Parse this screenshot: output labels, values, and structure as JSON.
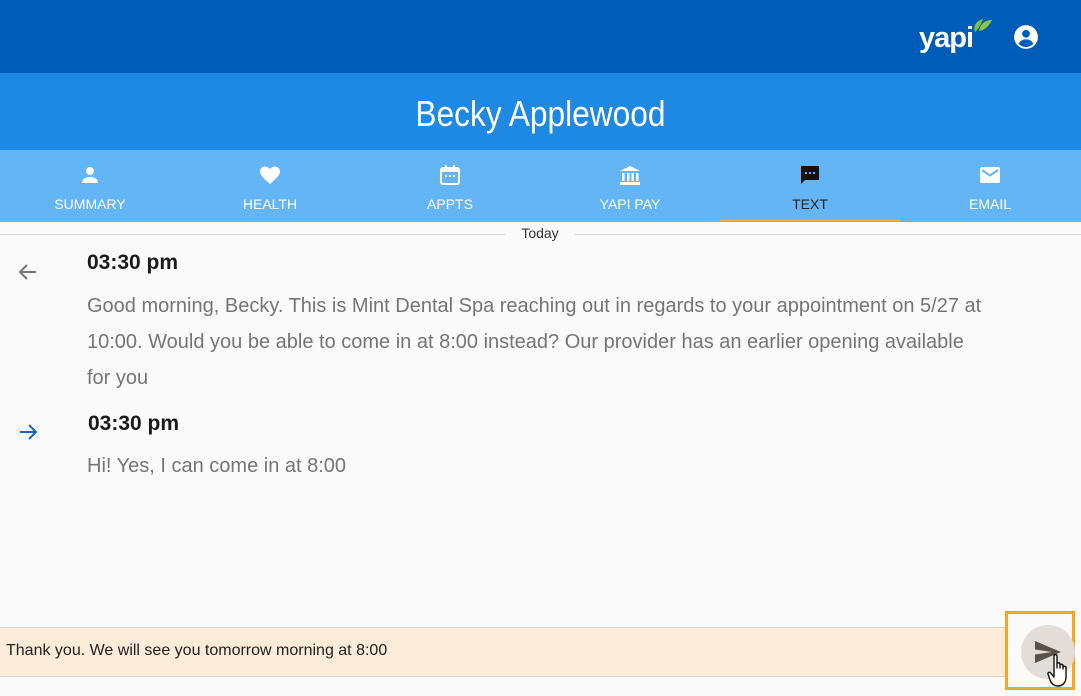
{
  "app": {
    "logo_text": "yapi",
    "brand_color": "#005cb9",
    "accent_color": "#f5a623"
  },
  "header": {
    "account_icon": "account-circle-icon"
  },
  "patient": {
    "name": "Becky Applewood"
  },
  "tabs": [
    {
      "label": "SUMMARY",
      "icon": "person-icon",
      "active": false
    },
    {
      "label": "HEALTH",
      "icon": "heart-icon",
      "active": false
    },
    {
      "label": "APPTS",
      "icon": "calendar-icon",
      "active": false
    },
    {
      "label": "YAPI PAY",
      "icon": "bank-icon",
      "active": false
    },
    {
      "label": "TEXT",
      "icon": "chat-icon",
      "active": true
    },
    {
      "label": "EMAIL",
      "icon": "mail-icon",
      "active": false
    }
  ],
  "conversation": {
    "date_divider": "Today",
    "messages": [
      {
        "direction": "outgoing",
        "icon": "arrow-left-icon",
        "time": "03:30 pm",
        "text": "Good morning, Becky. This is Mint Dental Spa reaching out in regards to your appointment on 5/27 at 10:00. Would you be able to come in at 8:00 instead? Our provider has an earlier opening available for you"
      },
      {
        "direction": "incoming",
        "icon": "arrow-right-icon",
        "time": "03:30 pm",
        "text": "Hi! Yes, I can come in at 8:00"
      }
    ]
  },
  "composer": {
    "value": "Thank you. We will see you tomorrow morning at 8:00",
    "send_icon": "send-icon"
  }
}
